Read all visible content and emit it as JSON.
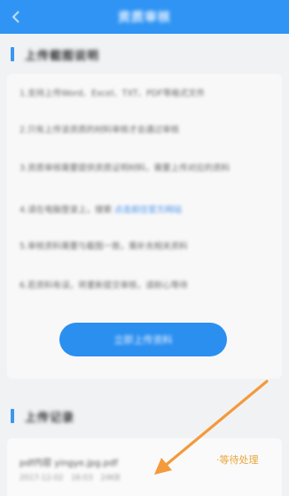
{
  "header": {
    "title": "资质审核",
    "back_icon": "chevron-left-icon"
  },
  "rules_section": {
    "title": "上传截图说明",
    "rules": [
      "1.支持上传Word、Excel、TXT、PDF等格式文件",
      "2.只有上传该资质的材料审核才会通过审核",
      "3.资质审核需要提供资质证明材料，需要上传对应的资料",
      "4.请在电脑登录上，搜索",
      "5.审核资料需要与截图一致，需补充相关资料",
      "6.若资料有误，将重新提交审核，请耐心等待"
    ],
    "rule4_link": "点击前往官方网站",
    "upload_button": "立即上传资料"
  },
  "records_section": {
    "title": "上传记录",
    "items": [
      {
        "name": "pdf内容 yingye.jpg.pdf",
        "date": "2017-12-02 16:03",
        "size": "24KB",
        "status": "·等待处理"
      }
    ]
  },
  "colors": {
    "accent": "#2f94f3",
    "status_pending": "#e8a53c",
    "annotation_arrow": "#f39a3c"
  }
}
